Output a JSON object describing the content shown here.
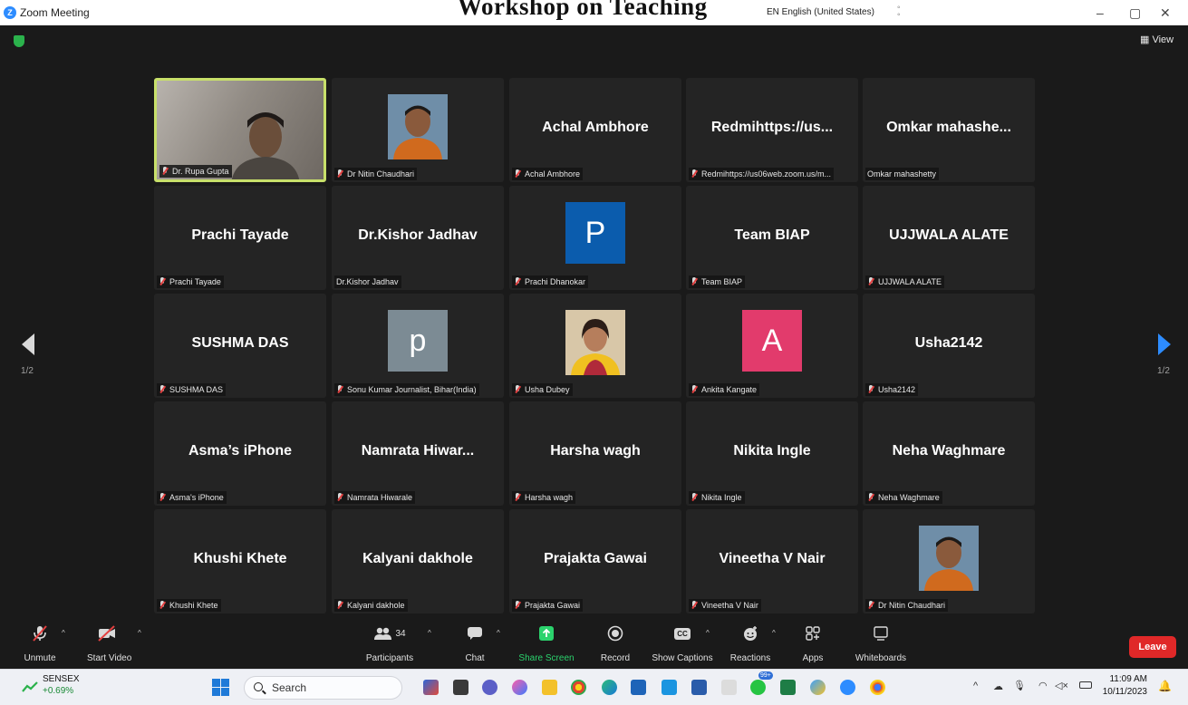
{
  "window": {
    "app_title": "Zoom Meeting",
    "overlay_heading": "Workshop on Teaching",
    "language": "EN English (United States)",
    "minimize": "–",
    "maximize": "▢",
    "close": "✕"
  },
  "view_button": "View",
  "pagination": {
    "left": "1/2",
    "right": "1/2"
  },
  "participants": [
    {
      "display": "",
      "label": "Dr. Rupa Gupta",
      "muted": true,
      "type": "video"
    },
    {
      "display": "",
      "label": "Dr Nitin Chaudhari",
      "muted": true,
      "type": "photo"
    },
    {
      "display": "Achal Ambhore",
      "label": "Achal Ambhore",
      "muted": true,
      "type": "name"
    },
    {
      "display": "Redmihttps://us...",
      "label": "Redmihttps://us06web.zoom.us/m...",
      "muted": true,
      "type": "name"
    },
    {
      "display": "Omkar  mahashe...",
      "label": "Omkar mahashetty",
      "muted": false,
      "type": "name"
    },
    {
      "display": "Prachi Tayade",
      "label": "Prachi Tayade",
      "muted": true,
      "type": "name"
    },
    {
      "display": "Dr.Kishor Jadhav",
      "label": "Dr.Kishor Jadhav",
      "muted": false,
      "type": "name"
    },
    {
      "display": "P",
      "label": "Prachi Dhanokar",
      "muted": true,
      "type": "letter",
      "color": "#0b5cad"
    },
    {
      "display": "Team BIAP",
      "label": "Team BIAP",
      "muted": true,
      "type": "name"
    },
    {
      "display": "UJJWALA ALATE",
      "label": "UJJWALA ALATE",
      "muted": true,
      "type": "name"
    },
    {
      "display": "SUSHMA DAS",
      "label": "SUSHMA DAS",
      "muted": true,
      "type": "name"
    },
    {
      "display": "p",
      "label": "Sonu Kumar Journalist, Bihar(India)",
      "muted": true,
      "type": "letter",
      "color": "#7c8b94"
    },
    {
      "display": "",
      "label": "Usha Dubey",
      "muted": true,
      "type": "photo2"
    },
    {
      "display": "A",
      "label": "Ankita Kangate",
      "muted": true,
      "type": "letter",
      "color": "#e23b6c"
    },
    {
      "display": "Usha2142",
      "label": "Usha2142",
      "muted": true,
      "type": "name"
    },
    {
      "display": "Asma’s iPhone",
      "label": "Asma's iPhone",
      "muted": true,
      "type": "name"
    },
    {
      "display": "Namrata  Hiwar...",
      "label": "Namrata Hiwarale",
      "muted": true,
      "type": "name"
    },
    {
      "display": "Harsha wagh",
      "label": "Harsha wagh",
      "muted": true,
      "type": "name"
    },
    {
      "display": "Nikita Ingle",
      "label": "Nikita Ingle",
      "muted": true,
      "type": "name"
    },
    {
      "display": "Neha Waghmare",
      "label": "Neha Waghmare",
      "muted": true,
      "type": "name"
    },
    {
      "display": "Khushi Khete",
      "label": "Khushi Khete",
      "muted": true,
      "type": "name"
    },
    {
      "display": "Kalyani dakhole",
      "label": "Kalyani dakhole",
      "muted": true,
      "type": "name"
    },
    {
      "display": "Prajakta Gawai",
      "label": "Prajakta Gawai",
      "muted": true,
      "type": "name"
    },
    {
      "display": "Vineetha V Nair",
      "label": "Vineetha V Nair",
      "muted": true,
      "type": "name"
    },
    {
      "display": "",
      "label": "Dr Nitin Chaudhari",
      "muted": true,
      "type": "photo"
    }
  ],
  "toolbar": {
    "unmute": "Unmute",
    "start_video": "Start Video",
    "participants": "Participants",
    "participant_count": "34",
    "chat": "Chat",
    "share_screen": "Share Screen",
    "record": "Record",
    "show_captions": "Show Captions",
    "captions_badge": "CC",
    "reactions": "Reactions",
    "apps": "Apps",
    "whiteboards": "Whiteboards",
    "leave": "Leave"
  },
  "taskbar": {
    "ticker_name": "SENSEX",
    "ticker_change": "+0.69%",
    "search_placeholder": "Search",
    "chat_badge": "99+",
    "time": "11:09 AM",
    "date": "10/11/2023"
  },
  "colors": {
    "accent": "#2d8cff",
    "leave": "#e02828",
    "share_green": "#2bd36d",
    "speaking_border": "#c8e06a"
  }
}
